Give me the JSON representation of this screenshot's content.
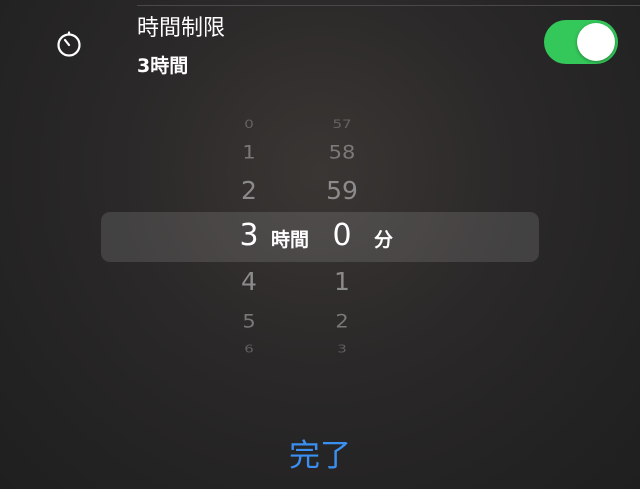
{
  "header": {
    "icon": "timer-icon",
    "title": "時間制限",
    "subtitle": "3時間",
    "toggle_on": true,
    "toggle_color": "#34c759"
  },
  "picker": {
    "hours": {
      "above": [
        "0",
        "1",
        "2"
      ],
      "selected": "3",
      "below": [
        "4",
        "5",
        "6"
      ],
      "unit": "時間"
    },
    "minutes": {
      "above": [
        "57",
        "58",
        "59"
      ],
      "selected": "0",
      "below": [
        "1",
        "2",
        "3"
      ],
      "unit": "分"
    }
  },
  "done_button": {
    "label": "完了",
    "color": "#3a8ff0"
  }
}
